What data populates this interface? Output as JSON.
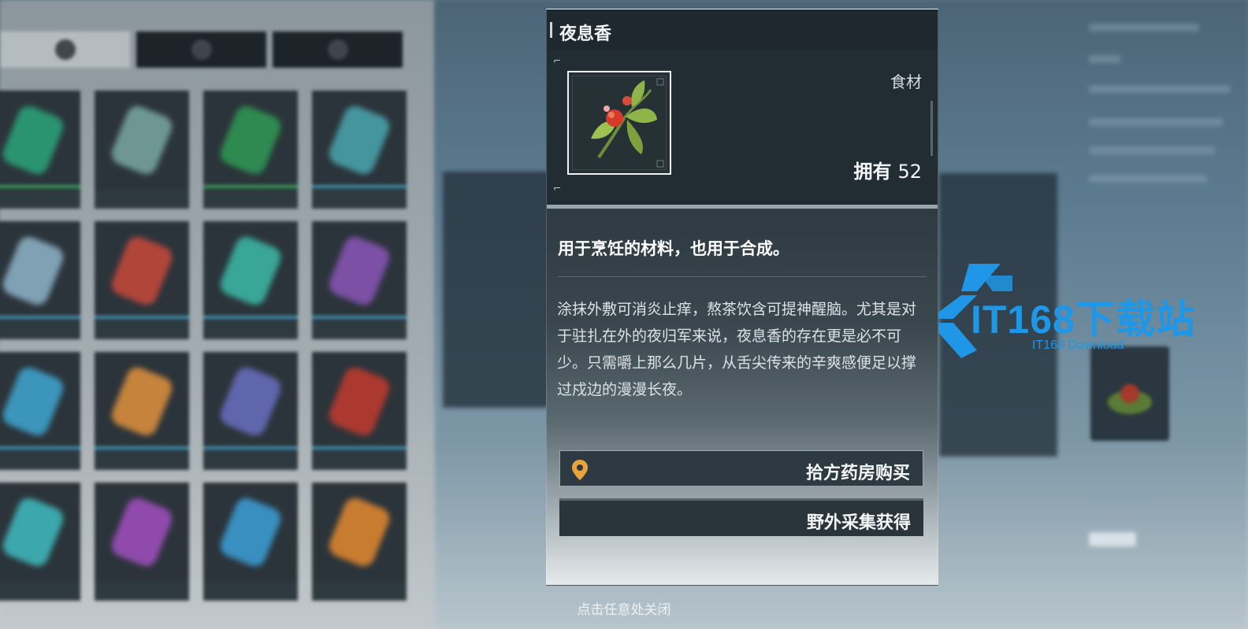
{
  "item": {
    "name": "夜息香",
    "category": "食材",
    "owned_label": "拥有",
    "owned_count": "52",
    "summary": "用于烹饪的材料，也用于合成。",
    "description": "涂抹外敷可消炎止痒，熬茶饮含可提神醒脑。尤其是对于驻扎在外的夜归军来说，夜息香的存在更是必不可少。只需嚼上那么几片，从舌尖传来的辛爽感便足以撑过戍边的漫漫长夜。",
    "icon": "herb-flower-icon"
  },
  "sources": [
    {
      "label": "拾方药房购买",
      "icon": "location-pin-icon"
    },
    {
      "label": "野外采集获得"
    }
  ],
  "close_hint": "点击任意处关闭",
  "watermark": {
    "text": "IT168下载站",
    "sub": "IT168 Download"
  },
  "colors": {
    "pin": "#e8a33c",
    "watermark": "#1f97e6"
  }
}
